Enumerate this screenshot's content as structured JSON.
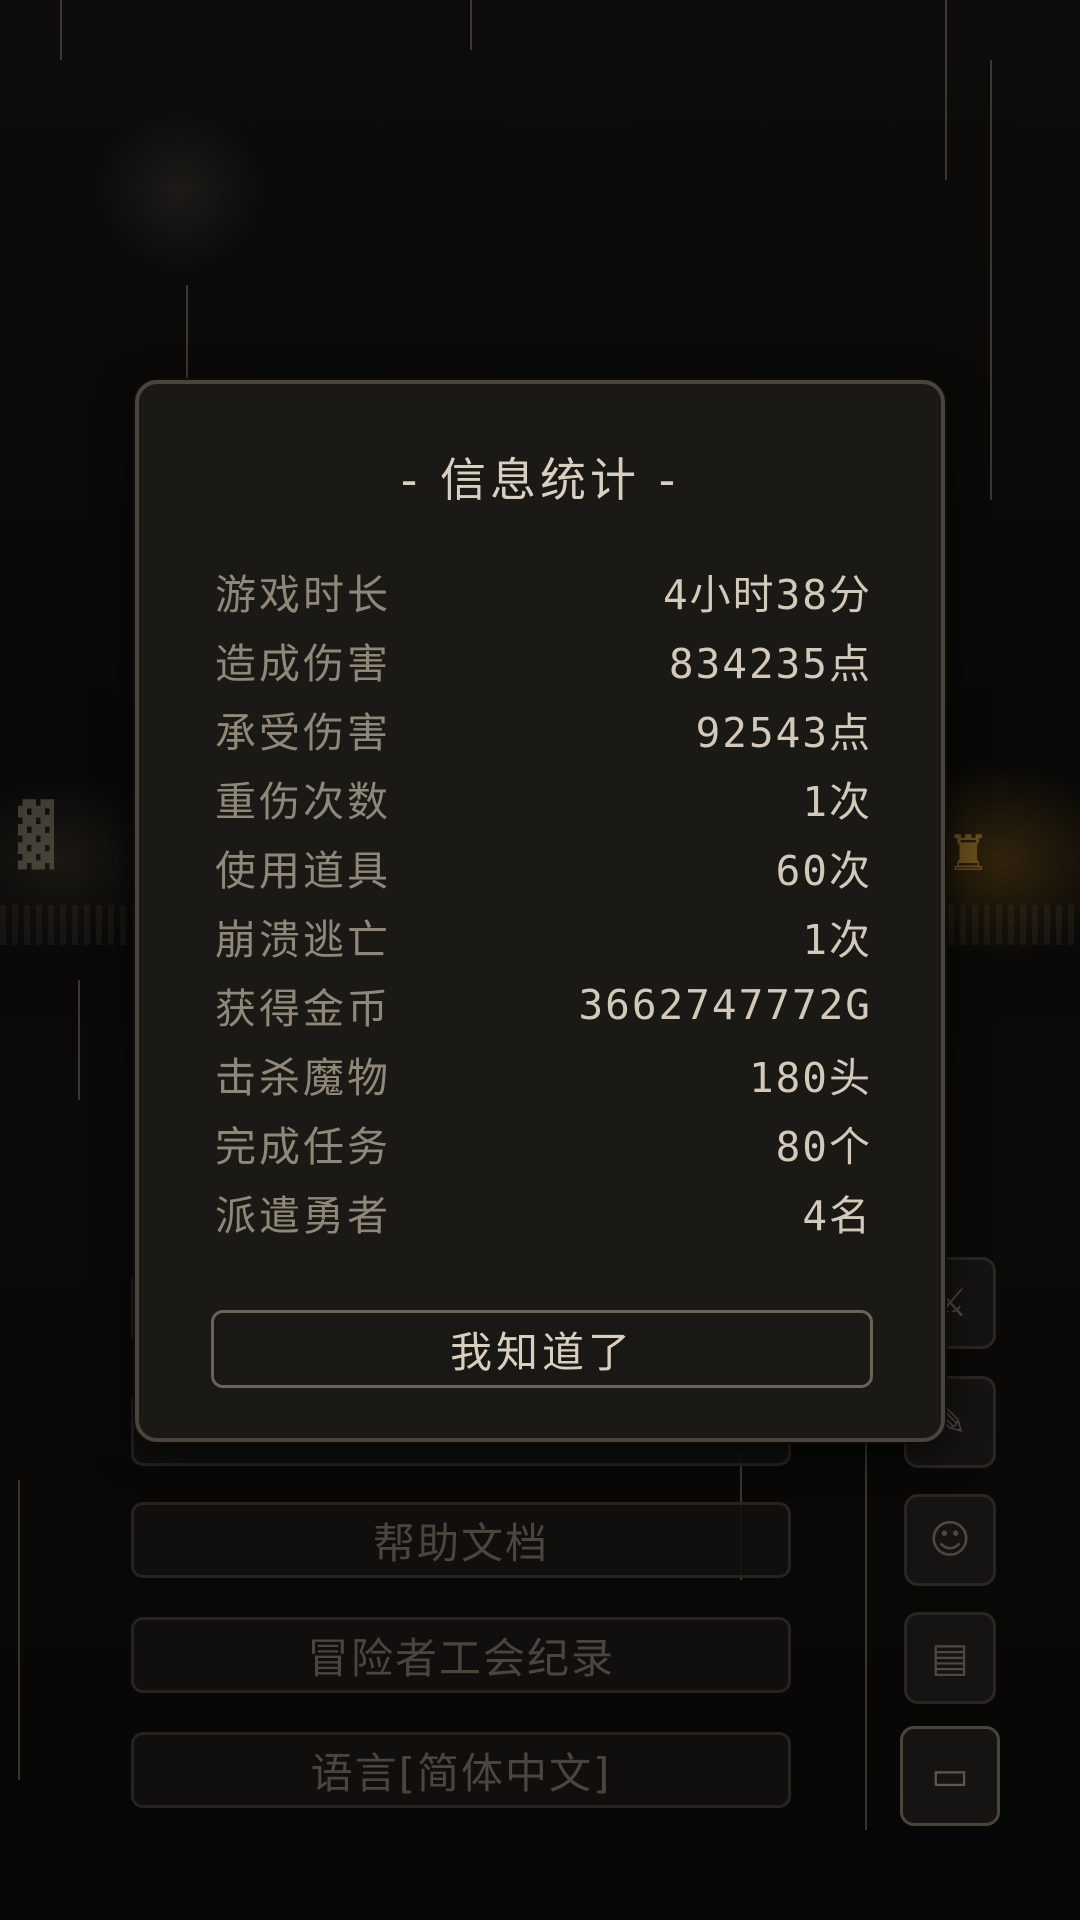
{
  "dialog": {
    "title": "- 信息统计 -",
    "stats": [
      {
        "label": "游戏时长",
        "value": "4小时38分"
      },
      {
        "label": "造成伤害",
        "value": "834235点"
      },
      {
        "label": "承受伤害",
        "value": "92543点"
      },
      {
        "label": "重伤次数",
        "value": "1次"
      },
      {
        "label": "使用道具",
        "value": "60次"
      },
      {
        "label": "崩溃逃亡",
        "value": "1次"
      },
      {
        "label": "获得金币",
        "value": "3662747772G"
      },
      {
        "label": "击杀魔物",
        "value": "180头"
      },
      {
        "label": "完成任务",
        "value": "80个"
      },
      {
        "label": "派遣勇者",
        "value": "4名"
      }
    ],
    "confirm_label": "我知道了"
  },
  "background_menu": {
    "items": [
      "帮助文档",
      "冒险者工会纪录",
      "语言[简体中文]"
    ]
  },
  "side_icons": [
    "sword-icon",
    "quill-icon",
    "cat-icon",
    "document-icon",
    "computer-icon"
  ]
}
